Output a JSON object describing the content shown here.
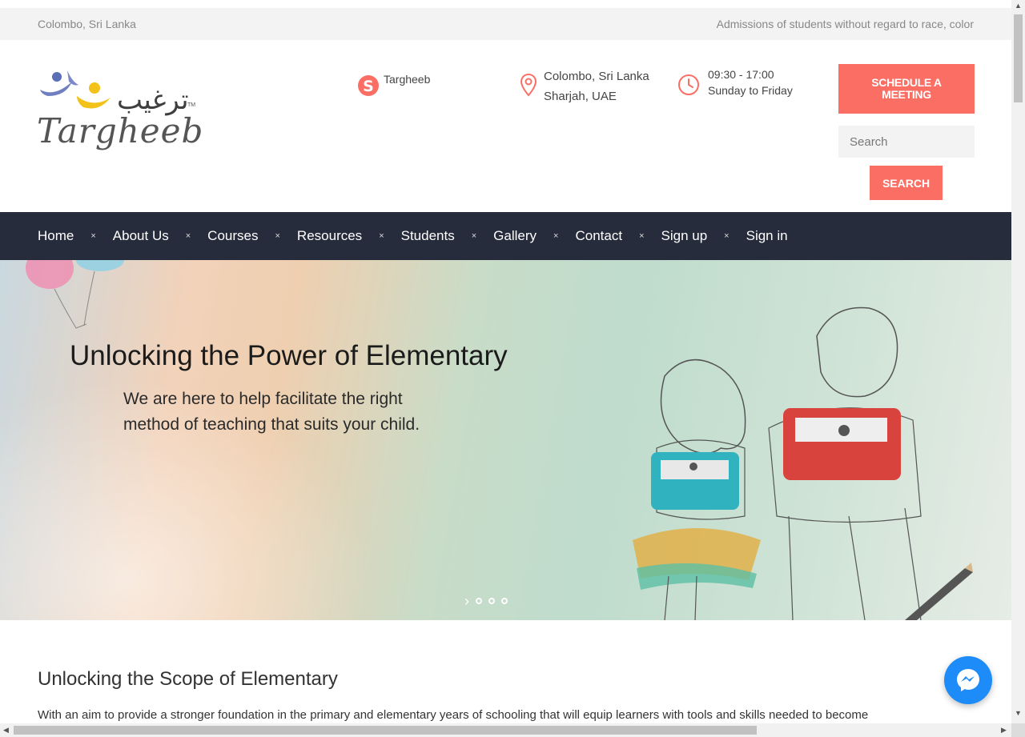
{
  "topbar": {
    "location": "Colombo, Sri Lanka",
    "notice": "Admissions of students without regard to race, color"
  },
  "header": {
    "logo_text": "Targheeb",
    "logo_arabic": "ترغيب",
    "logo_tm": "TM",
    "skype_label": "Targheeb",
    "address_line1": "Colombo, Sri Lanka",
    "address_line2": "Sharjah, UAE",
    "hours_line1": "09:30 - 17:00",
    "hours_line2": "Sunday to Friday",
    "schedule_button": "SCHEDULE A MEETING",
    "search_placeholder": "Search",
    "search_button": "SEARCH"
  },
  "nav": {
    "items": [
      "Home",
      "About Us",
      "Courses",
      "Resources",
      "Students",
      "Gallery",
      "Contact",
      "Sign up",
      "Sign in"
    ],
    "separator": "×"
  },
  "hero": {
    "title": "Unlocking the Power of Elementary",
    "subtitle": "We are here to help facilitate the right method of teaching that suits your child.",
    "slide_count": 3
  },
  "section": {
    "title": "Unlocking the Scope of Elementary",
    "body": "With an aim to provide a stronger foundation in the primary and elementary years of schooling that will equip learners with tools and skills needed to become"
  },
  "colors": {
    "accent": "#fb6e64",
    "nav_bg": "#272c3c",
    "messenger": "#1e8cf8"
  },
  "icons": [
    "skype-icon",
    "map-pin-icon",
    "clock-icon",
    "messenger-icon",
    "chevron-right-icon"
  ]
}
